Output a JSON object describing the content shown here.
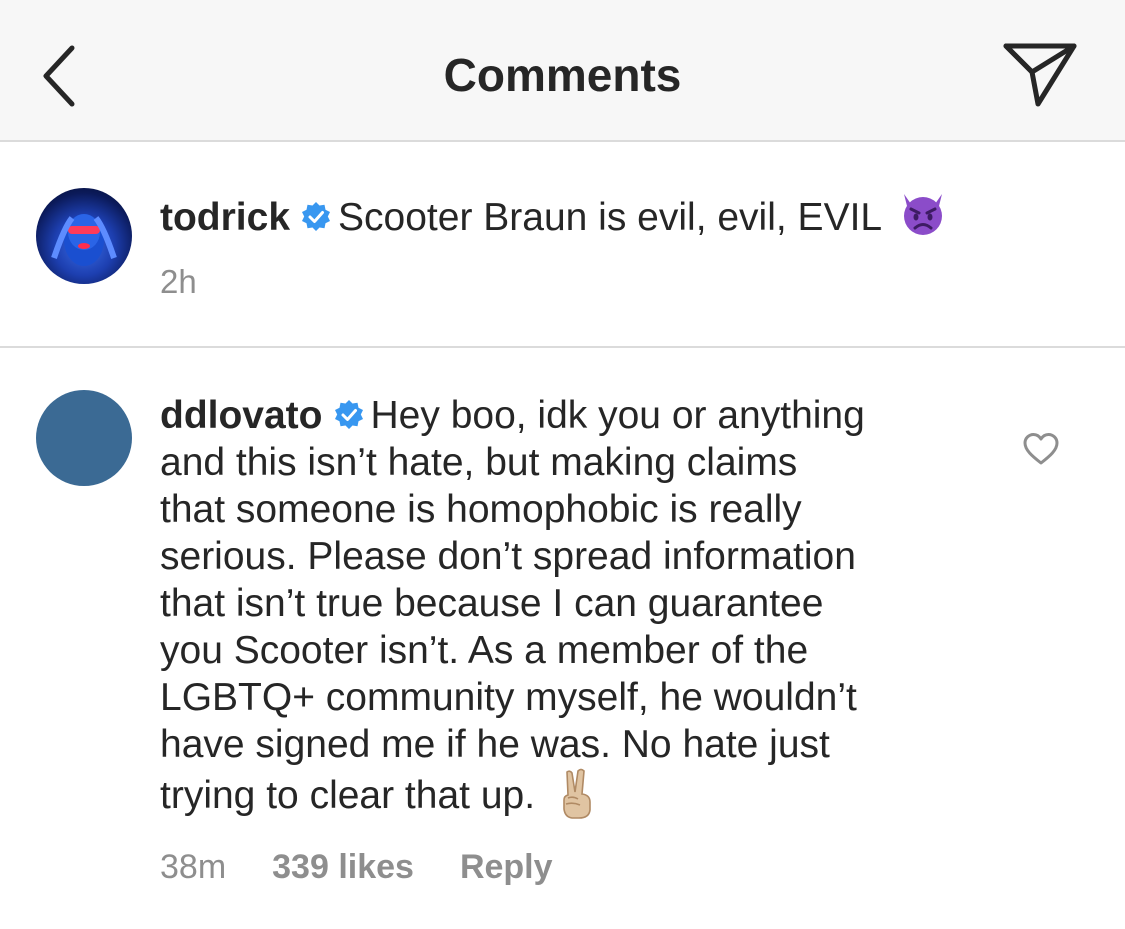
{
  "header": {
    "title": "Comments",
    "back_icon": "chevron-left-icon",
    "send_icon": "paper-plane-icon"
  },
  "caption": {
    "username": "todrick",
    "text": "Scooter Braun is evil, evil, EVIL",
    "emoji": "angry-devil-emoji",
    "time": "2h"
  },
  "reply": {
    "username": "ddlovato",
    "lines": [
      "Hey boo, idk you or anything",
      "and this isn’t hate, but making claims",
      "that someone is homophobic is really",
      "serious. Please don’t spread information",
      "that isn’t true because I can guarantee",
      "you Scooter isn’t. As a member of the",
      "LGBTQ+ community myself, he wouldn’t",
      "have signed me if he was. No hate just",
      "trying to clear that up."
    ],
    "emoji": "victory-hand-emoji",
    "time": "38m",
    "likes": "339 likes",
    "reply_label": "Reply",
    "heart_icon": "heart-outline-icon"
  },
  "colors": {
    "verified": "#3897f0",
    "secondary_text": "#8e8e8e",
    "primary_text": "#262626",
    "header_bg": "#f7f7f7",
    "divider": "#dbdbdb"
  }
}
